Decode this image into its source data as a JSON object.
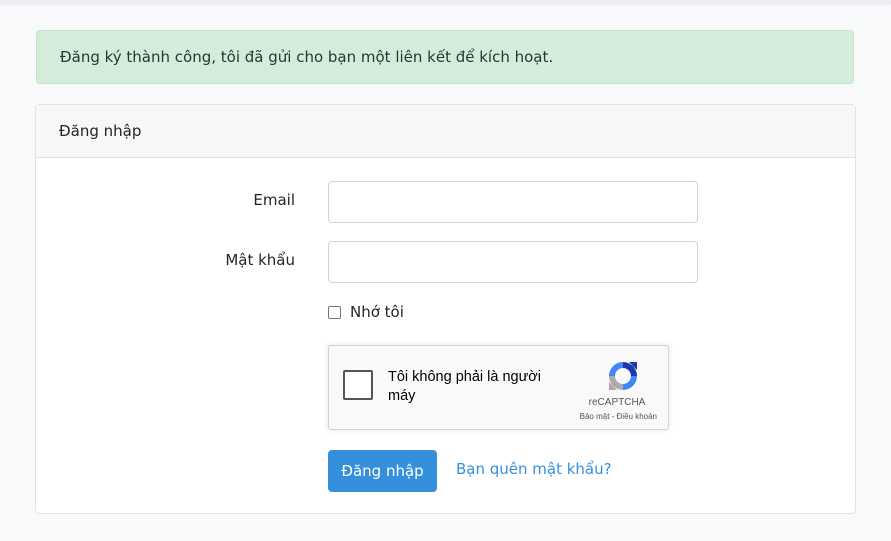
{
  "alert": {
    "message": "Đăng ký thành công, tôi đã gửi cho bạn một liên kết để kích hoạt."
  },
  "card": {
    "header_title": "Đăng nhập"
  },
  "form": {
    "email_label": "Email",
    "email_value": "",
    "password_label": "Mật khẩu",
    "password_value": "",
    "remember_label": "Nhớ tôi",
    "remember_checked": false,
    "submit_label": "Đăng nhập",
    "forgot_link": "Bạn quên mật khẩu?"
  },
  "recaptcha": {
    "checkbox_text": "Tôi không phải là người máy",
    "brand": "reCAPTCHA",
    "terms": "Bảo mật - Điều khoản",
    "logo_icon": "recaptcha-logo-icon"
  },
  "colors": {
    "primary": "#3490dc",
    "alert_success_bg": "#d4edda",
    "card_header_bg": "#f7f7f7"
  }
}
